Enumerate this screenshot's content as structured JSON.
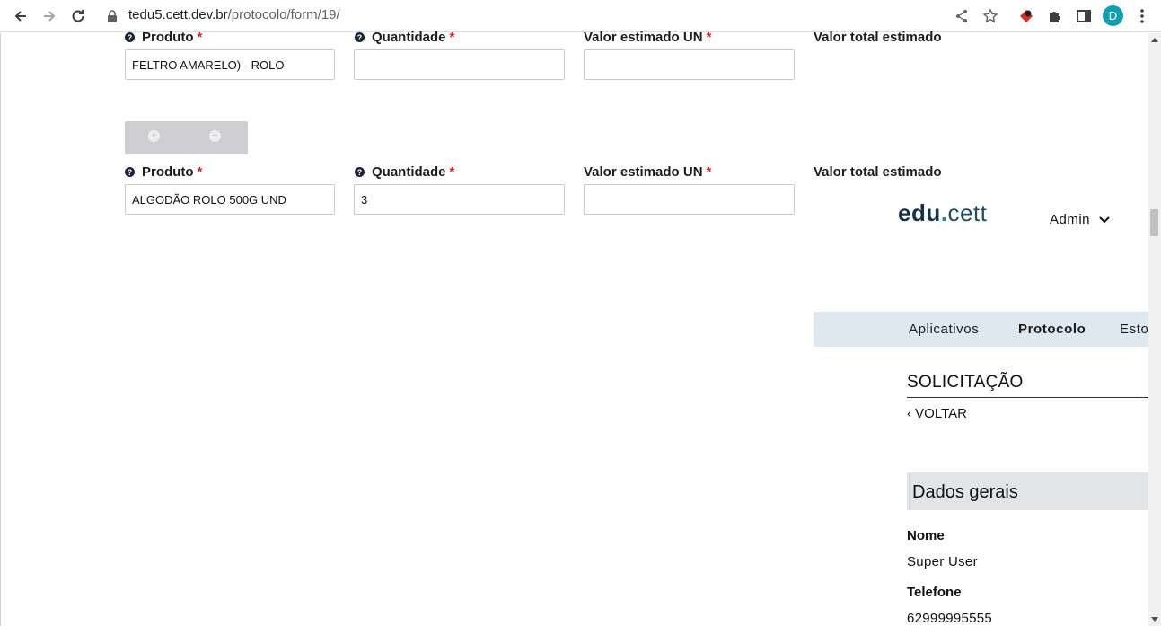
{
  "browser": {
    "url_host": "tedu5.cett.dev.br",
    "url_path": "/protocolo/form/19/",
    "profile_initial": "D"
  },
  "form": {
    "rows": [
      {
        "product_label": "Produto",
        "quantity_label": "Quantidade",
        "unit_value_label": "Valor estimado UN",
        "total_value_label": "Valor total estimado",
        "required_mark": "*",
        "product_value": "FELTRO AMARELO) - ROLO",
        "quantity_value": "",
        "unit_value": ""
      },
      {
        "product_label": "Produto",
        "quantity_label": "Quantidade",
        "unit_value_label": "Valor estimado UN",
        "total_value_label": "Valor total estimado",
        "required_mark": "*",
        "product_value": "ALGODÃO ROLO 500G UND",
        "quantity_value": "3",
        "unit_value": ""
      }
    ],
    "add_symbol": "+",
    "remove_symbol": "−",
    "help_symbol": "?"
  },
  "header": {
    "logo_edu": "edu",
    "logo_dot": ".",
    "logo_cett": "cett",
    "admin_label": "Admin"
  },
  "nav": {
    "items": [
      "Aplicativos",
      "Protocolo",
      "Estoque"
    ],
    "active": "Protocolo"
  },
  "page": {
    "title": "SOLICITAÇÃO",
    "back_label": "VOLTAR",
    "back_chevron": "‹"
  },
  "general": {
    "header": "Dados gerais",
    "name_label": "Nome",
    "name_value": "Super User",
    "phone_label": "Telefone",
    "phone_value": "62999995555"
  },
  "colors": {
    "accent": "#14324a",
    "required": "#e01b24",
    "nav_bg": "#e0e8ef",
    "avatar": "#129eaf"
  }
}
